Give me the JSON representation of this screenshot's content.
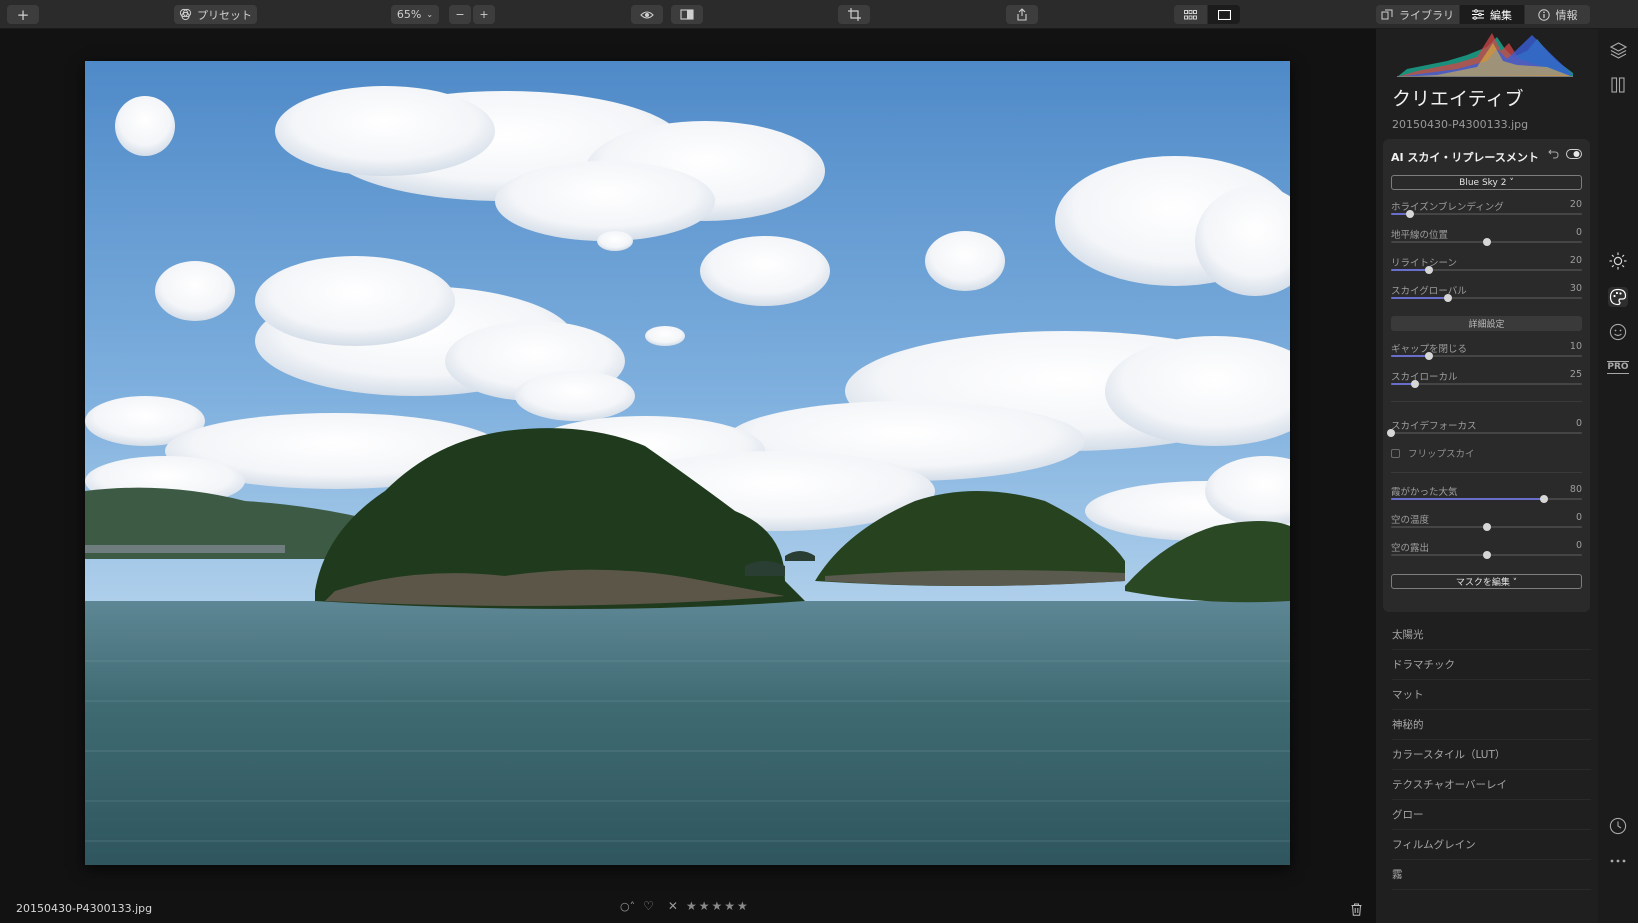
{
  "toolbar": {
    "add_label": "+",
    "preset_label": "プリセット",
    "zoom_value": "65%",
    "zoom_out": "−",
    "zoom_in": "+",
    "tabs": [
      {
        "label": "ライブラリ",
        "icon": "library-icon"
      },
      {
        "label": "編集",
        "icon": "sliders-icon"
      },
      {
        "label": "情報",
        "icon": "info-icon"
      }
    ]
  },
  "canvas": {
    "filename": "20150430-P4300133.jpg",
    "rating_stars": "★★★★★",
    "reject_mark": "✕"
  },
  "panel": {
    "title": "クリエイティブ",
    "filename": "20150430-P4300133.jpg",
    "tool": {
      "name": "AI スカイ・リプレースメント",
      "sky_select": "Blue Sky 2 ˅",
      "sliders": [
        {
          "label": "ホライズンブレンディング",
          "value": "20",
          "pos": 0.1,
          "fill": true
        },
        {
          "label": "地平線の位置",
          "value": "0",
          "pos": 0.5,
          "fill": false
        },
        {
          "label": "リライトシーン",
          "value": "20",
          "pos": 0.2,
          "fill": true
        },
        {
          "label": "スカイグローバル",
          "value": "30",
          "pos": 0.3,
          "fill": true
        }
      ],
      "advanced_label": "詳細設定",
      "sliders2": [
        {
          "label": "ギャップを閉じる",
          "value": "10",
          "pos": 0.2,
          "fill": true
        },
        {
          "label": "スカイローカル",
          "value": "25",
          "pos": 0.125,
          "fill": true
        }
      ],
      "sliders3": [
        {
          "label": "スカイデフォーカス",
          "value": "0",
          "pos": 0.0,
          "fill": false
        }
      ],
      "flip_label": "フリップスカイ",
      "sliders4": [
        {
          "label": "霞がかった大気",
          "value": "80",
          "pos": 0.8,
          "fill": true
        },
        {
          "label": "空の温度",
          "value": "0",
          "pos": 0.5,
          "fill": false
        },
        {
          "label": "空の露出",
          "value": "0",
          "pos": 0.5,
          "fill": false
        }
      ],
      "mask_label": "マスクを編集 ˅"
    },
    "sections": [
      "太陽光",
      "ドラマチック",
      "マット",
      "神秘的",
      "カラースタイル（LUT）",
      "テクスチャオーバーレイ",
      "グロー",
      "フィルムグレイン",
      "霧"
    ]
  },
  "rail": {
    "pro_label": "PRO"
  },
  "colors": {
    "accent": "#6a6ecb",
    "panel_bg": "#1f1f1f",
    "toolbar_bg": "#2b2b2b"
  }
}
